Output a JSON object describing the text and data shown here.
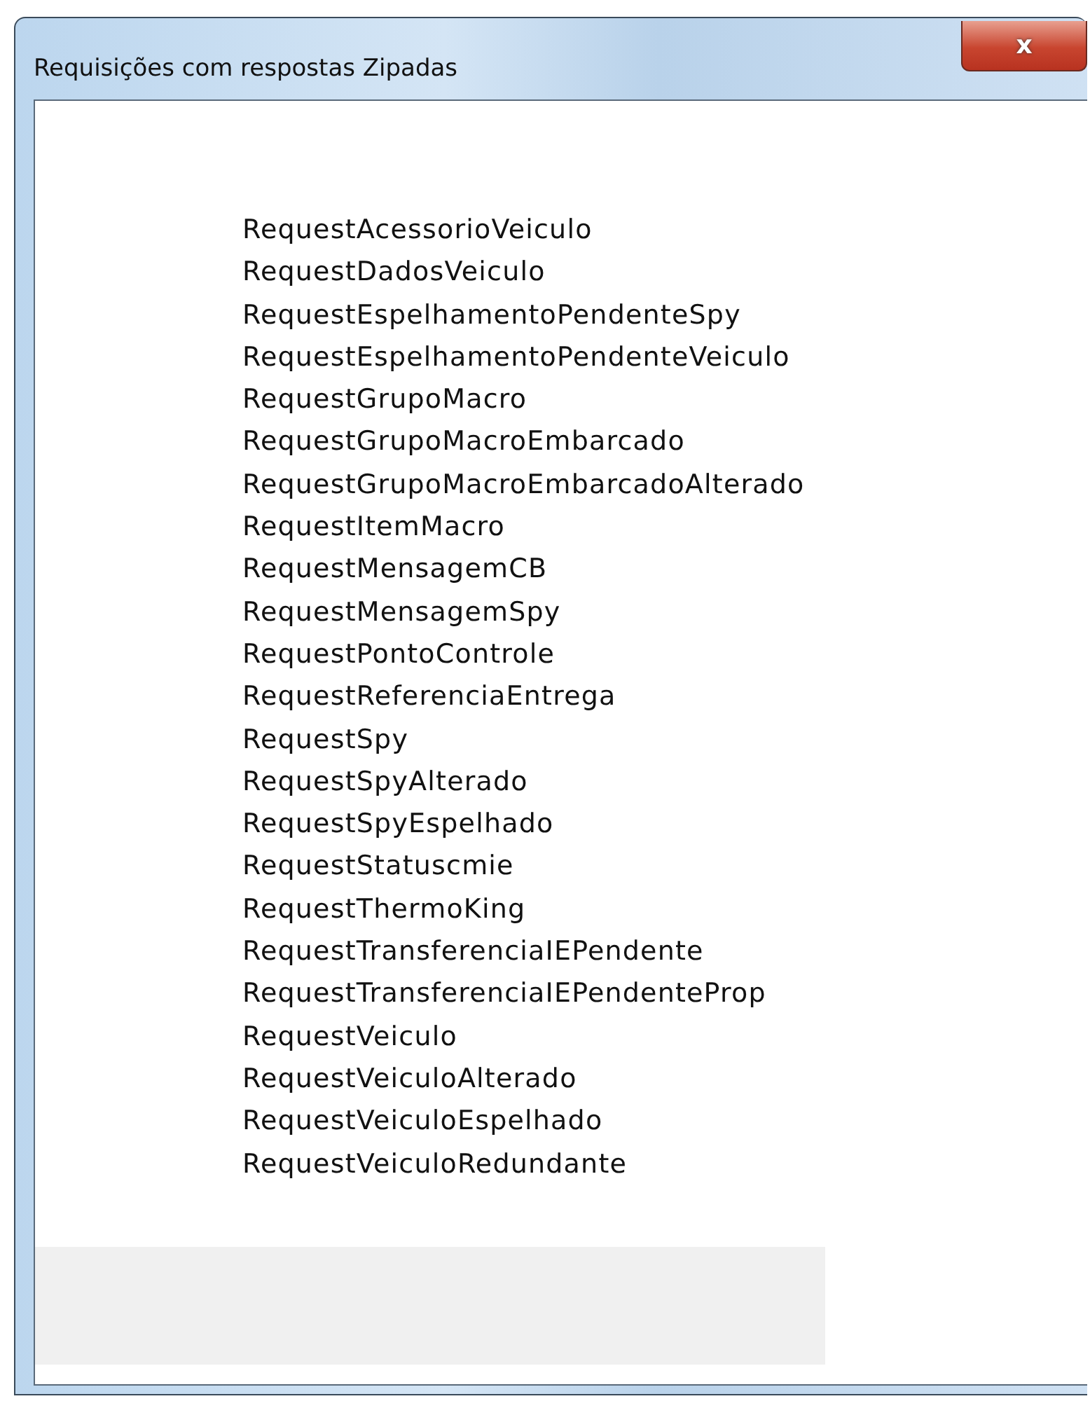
{
  "window": {
    "title": "Requisições com respostas Zipadas",
    "close_button": "x"
  },
  "items": [
    "RequestAcessorioVeiculo",
    "RequestDadosVeiculo",
    "RequestEspelhamentoPendenteSpy",
    "RequestEspelhamentoPendenteVeiculo",
    "RequestGrupoMacro",
    "RequestGrupoMacroEmbarcado",
    "RequestGrupoMacroEmbarcadoAlterado",
    "RequestItemMacro",
    "RequestMensagemCB",
    "RequestMensagemSpy",
    "RequestPontoControle",
    "RequestReferenciaEntrega",
    "RequestSpy",
    "RequestSpyAlterado",
    "RequestSpyEspelhado",
    "RequestStatuscmie",
    "RequestThermoKing",
    "RequestTransferenciaIEPendente",
    "RequestTransferenciaIEPendenteProp",
    "RequestVeiculo",
    "RequestVeiculoAlterado",
    "RequestVeiculoEspelhado",
    "RequestVeiculoRedundante"
  ]
}
